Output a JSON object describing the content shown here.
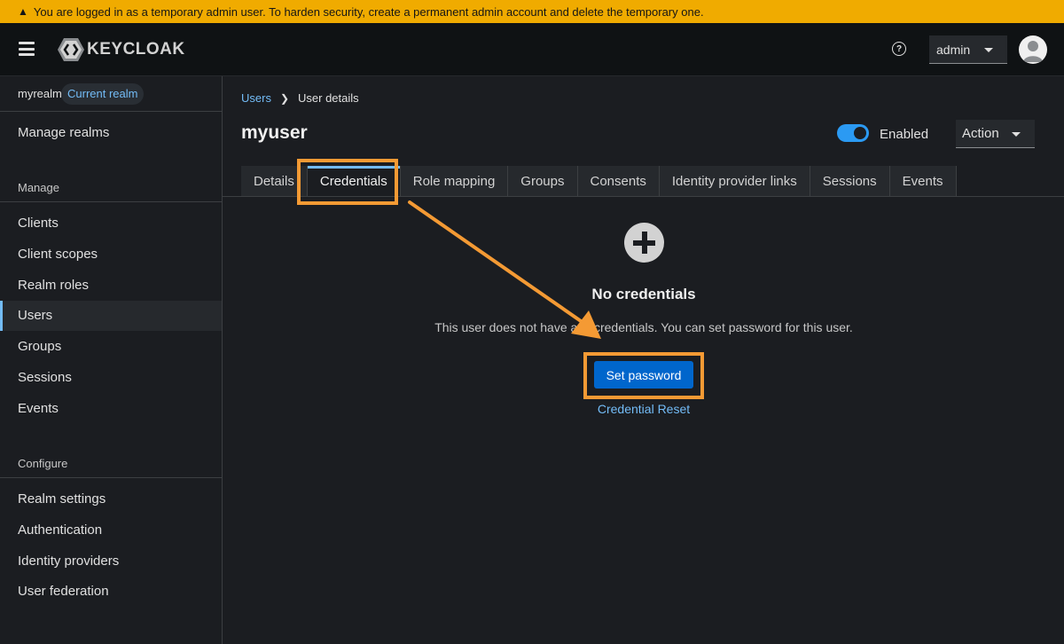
{
  "banner": {
    "text": "You are logged in as a temporary admin user. To harden security, create a permanent admin account and delete the temporary one."
  },
  "header": {
    "logo_text": "KEYCLOAK",
    "user_menu": "admin"
  },
  "sidebar": {
    "realm_name": "myrealm",
    "realm_badge": "Current realm",
    "manage_realms": "Manage realms",
    "manage_section": "Manage",
    "manage_items": [
      "Clients",
      "Client scopes",
      "Realm roles",
      "Users",
      "Groups",
      "Sessions",
      "Events"
    ],
    "configure_section": "Configure",
    "configure_items": [
      "Realm settings",
      "Authentication",
      "Identity providers",
      "User federation"
    ]
  },
  "breadcrumb": {
    "parent": "Users",
    "current": "User details"
  },
  "page": {
    "title": "myuser",
    "enabled_label": "Enabled",
    "action_label": "Action"
  },
  "tabs": [
    "Details",
    "Credentials",
    "Role mapping",
    "Groups",
    "Consents",
    "Identity provider links",
    "Sessions",
    "Events"
  ],
  "empty_state": {
    "title": "No credentials",
    "body": "This user does not have any credentials. You can set password for this user.",
    "primary_button": "Set password",
    "link": "Credential Reset"
  },
  "colors": {
    "accent": "#73bcf7",
    "primary": "#0066cc",
    "banner": "#f0ab00",
    "annotation": "#f49a34"
  }
}
